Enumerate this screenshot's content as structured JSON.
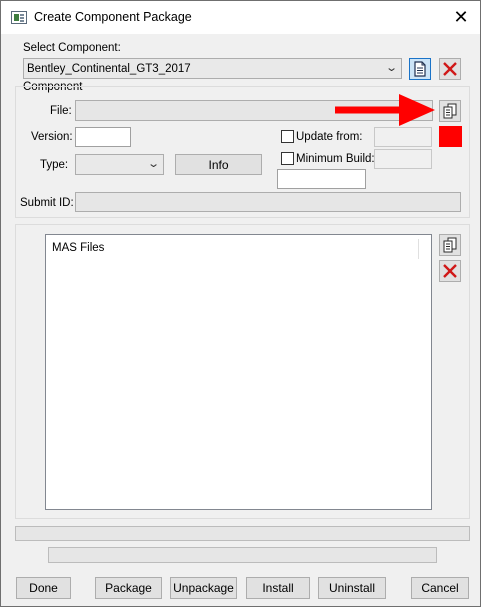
{
  "window": {
    "title": "Create Component Package",
    "close_glyph": "✕"
  },
  "select_component": {
    "label": "Select Component:",
    "value": "Bentley_Continental_GT3_2017"
  },
  "component_group": {
    "legend": "Component"
  },
  "file": {
    "label": "File:",
    "value": ""
  },
  "version": {
    "label": "Version:",
    "value": ""
  },
  "update_from": {
    "label": "Update from:",
    "value": ""
  },
  "type": {
    "label": "Type:",
    "value": ""
  },
  "info_button": {
    "label": "Info"
  },
  "minimum_build": {
    "label": "Minimum Build:",
    "value": ""
  },
  "submit_id": {
    "label": "Submit ID:",
    "value": ""
  },
  "mas_files": {
    "column_header": "MAS Files",
    "items": []
  },
  "buttons": {
    "done": "Done",
    "package": "Package",
    "unpackage": "Unpackage",
    "install": "Install",
    "uninstall": "Uninstall",
    "cancel": "Cancel"
  },
  "colors": {
    "annotation_arrow": "#ff0000",
    "status_box": "#ff0000",
    "selected_button_border": "#1a73c8"
  },
  "icons": [
    "window-app-icon",
    "close-icon",
    "document-icon",
    "delete-x-icon",
    "files-icon",
    "chevron-down-icon",
    "annotation-arrow-icon"
  ]
}
